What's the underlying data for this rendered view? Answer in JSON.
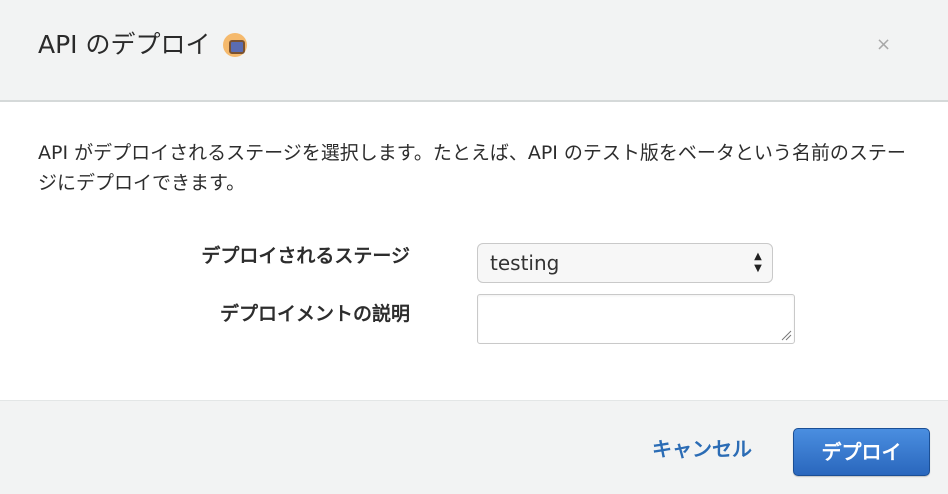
{
  "dialog": {
    "title": "API のデプロイ",
    "close_glyph": "×",
    "description": "API がデプロイされるステージを選択します。たとえば、API のテスト版をベータという名前のステージにデプロイできます。"
  },
  "form": {
    "stage_label": "デプロイされるステージ",
    "stage_value": "testing",
    "stage_options": [
      "testing"
    ],
    "description_label": "デプロイメントの説明",
    "description_value": ""
  },
  "footer": {
    "cancel_label": "キャンセル",
    "deploy_label": "デプロイ"
  },
  "icons": {
    "close": "close-icon",
    "badge": "beta-badge-icon",
    "select_arrows": "up-down-arrows-icon",
    "resize": "resize-grip-icon"
  },
  "colors": {
    "header_bg": "#f2f3f3",
    "primary": "#2a67bd",
    "link": "#2b6cb5",
    "badge": "#f5b96c"
  }
}
